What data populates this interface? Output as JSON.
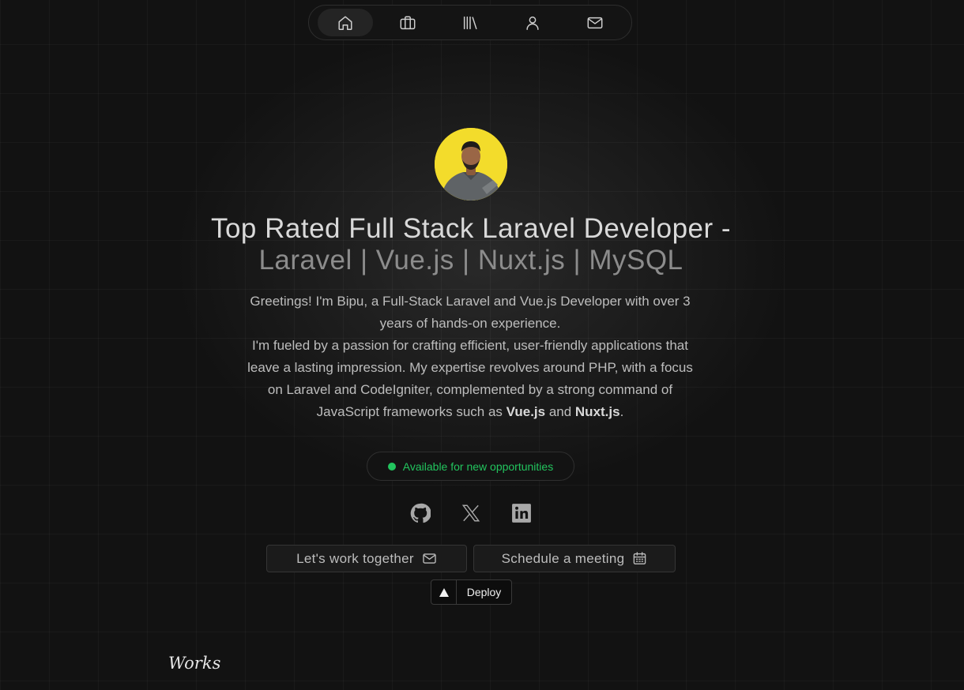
{
  "nav": {
    "items": [
      {
        "icon": "home-icon",
        "active": true
      },
      {
        "icon": "briefcase-icon",
        "active": false
      },
      {
        "icon": "library-icon",
        "active": false
      },
      {
        "icon": "user-icon",
        "active": false
      },
      {
        "icon": "mail-icon",
        "active": false
      }
    ]
  },
  "hero": {
    "headline_line1": "Top Rated Full Stack Laravel Developer -",
    "headline_line2": "Laravel | Vue.js | Nuxt.js | MySQL",
    "bio_line1": "Greetings! I'm Bipu, a Full-Stack Laravel and Vue.js Developer with over 3 years of hands-on experience.",
    "bio_line2_before": "I'm fueled by a passion for crafting efficient, user-friendly applications that leave a lasting impression. My expertise revolves around PHP, with a focus on Laravel and CodeIgniter, complemented by a strong command of JavaScript frameworks such as ",
    "bio_strong_1": "Vue.js",
    "bio_and": " and ",
    "bio_strong_2": "Nuxt.js",
    "bio_end": "."
  },
  "status": {
    "text": "Available for new opportunities",
    "color": "#22c55e"
  },
  "socials": [
    {
      "icon": "github-icon"
    },
    {
      "icon": "x-icon"
    },
    {
      "icon": "linkedin-icon"
    }
  ],
  "actions": {
    "work_label": "Let's work together",
    "meeting_label": "Schedule a meeting"
  },
  "deploy": {
    "label": "Deploy"
  },
  "sections": {
    "works_title": "Works"
  },
  "colors": {
    "background": "#121212",
    "avatar_bg": "#f3dc2b",
    "accent_green": "#22c55e"
  }
}
